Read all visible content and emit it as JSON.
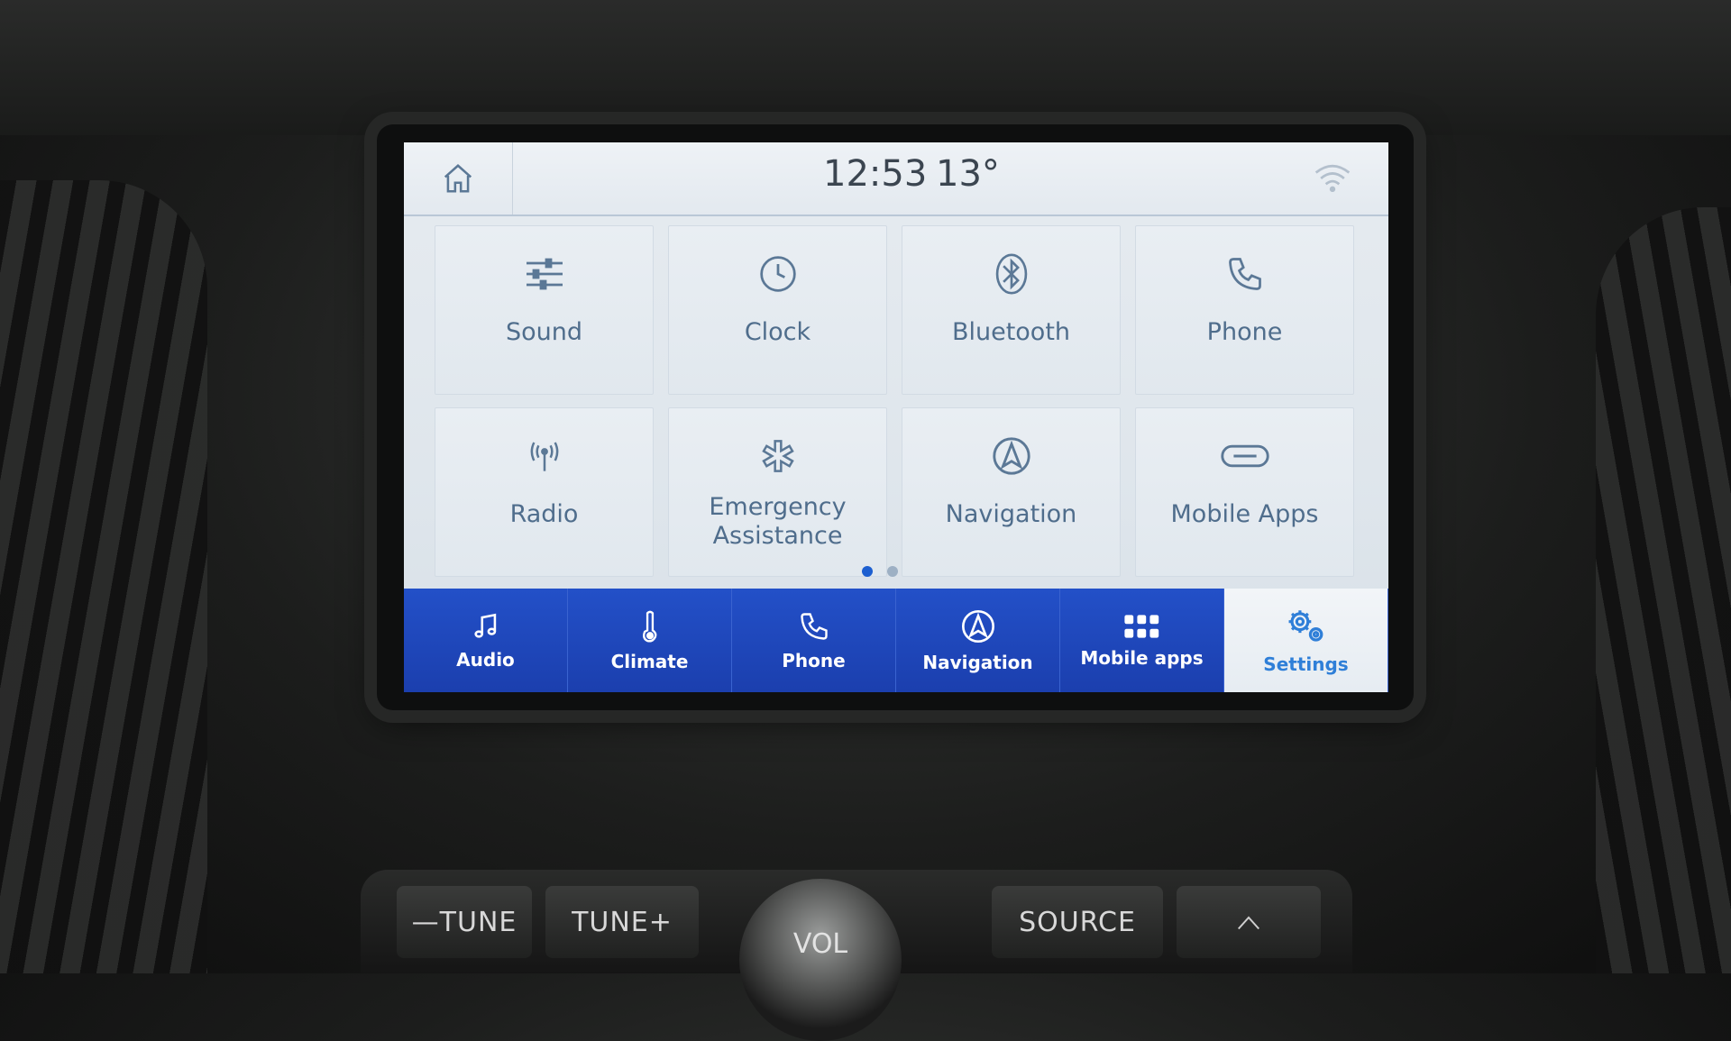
{
  "status_bar": {
    "time": "12:53",
    "temperature": "13°",
    "home_icon": "home-icon",
    "signal_icon": "wifi-icon"
  },
  "tiles": [
    {
      "label": "Sound",
      "icon": "sliders-icon"
    },
    {
      "label": "Clock",
      "icon": "clock-icon"
    },
    {
      "label": "Bluetooth",
      "icon": "bluetooth-icon"
    },
    {
      "label": "Phone",
      "icon": "phone-icon"
    },
    {
      "label": "Radio",
      "icon": "antenna-icon"
    },
    {
      "label": "Emergency Assistance",
      "icon": "asterisk-icon"
    },
    {
      "label": "Navigation",
      "icon": "navigation-icon"
    },
    {
      "label": "Mobile Apps",
      "icon": "link-icon"
    }
  ],
  "pagination": {
    "pages": 2,
    "current": 1
  },
  "bottom_nav": [
    {
      "label": "Audio",
      "icon": "music-note-icon",
      "active": false
    },
    {
      "label": "Climate",
      "icon": "thermometer-icon",
      "active": false
    },
    {
      "label": "Phone",
      "icon": "phone-icon",
      "active": false
    },
    {
      "label": "Navigation",
      "icon": "navigation-icon",
      "active": false
    },
    {
      "label": "Mobile apps",
      "icon": "app-grid-icon",
      "active": false
    },
    {
      "label": "Settings",
      "icon": "gears-icon",
      "active": true
    }
  ],
  "hardware": {
    "tune_minus": "—TUNE",
    "tune_plus": "TUNE+",
    "vol": "VOL",
    "source": "SOURCE"
  },
  "colors": {
    "nav_blue": "#1e46b8",
    "active_blue": "#2f7fd8",
    "tile_text": "#4f6d8c"
  }
}
